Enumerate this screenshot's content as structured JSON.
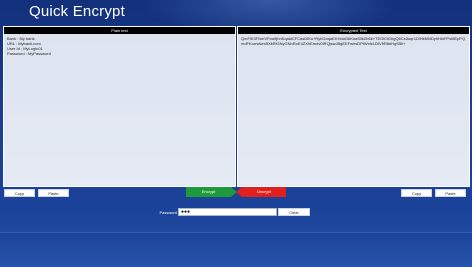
{
  "app": {
    "title": "Quick Encrypt"
  },
  "plain_panel": {
    "header": "Plain text",
    "lines": [
      "Bank : My bank",
      "URL : Mybank.com",
      "User Id : MyLogin01",
      "Password : MyPassword"
    ],
    "copy_label": "Copy",
    "paste_label": "Paste"
  },
  "encrypted_panel": {
    "header": "Encrypted Text",
    "text": "QmFlK3FNmVPoa9jhnKqaldCFCasDiKu+RybGoqaEKHduObKeaSilkZb6k+TEGt0IGIrgQ6Cs3uqr1DiHkMNDyhHIsFPsMEpPQmdFKorrsfwm5XkRlGNyGNnRoE4ZXhEmdv0IRQjswJBgEEFwhsDPfWxfzLDIVhR8riHgS5ll+",
    "copy_label": "Copy",
    "paste_label": "Paste"
  },
  "actions": {
    "encrypt_label": "Encrypt",
    "decrypt_label": "Decrypt",
    "encrypt_color": "#1d9b3c",
    "decrypt_color": "#e0201f"
  },
  "password": {
    "label": "Password",
    "value": "●●●",
    "clear_label": "Clear"
  }
}
